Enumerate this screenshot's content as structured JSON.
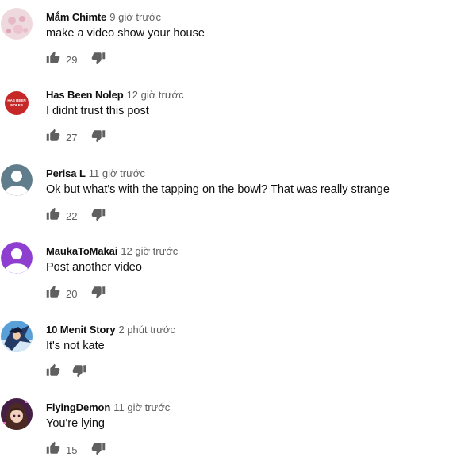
{
  "comments": [
    {
      "author": "Mắm Chimte",
      "time": "9 giờ trước",
      "text": "make a video show your house",
      "likes": "29",
      "avatar_icon": "pink-floral-avatar-icon"
    },
    {
      "author": "Has Been Nolep",
      "time": "12 giờ trước",
      "text": "I didnt trust this post",
      "likes": "27",
      "avatar_icon": "red-badge-avatar-icon",
      "avatar_text_1": "HAS BEEN",
      "avatar_text_2": "NOLEP"
    },
    {
      "author": "Perisa L",
      "time": "11 giờ trước",
      "text": "Ok but what's with the tapping on the bowl? That was really strange",
      "likes": "22",
      "avatar_icon": "default-gray-avatar-icon"
    },
    {
      "author": "MaukaToMakai",
      "time": "12 giờ trước",
      "text": "Post another video",
      "likes": "20",
      "avatar_icon": "default-purple-avatar-icon"
    },
    {
      "author": "10 Menit Story",
      "time": "2 phút trước",
      "text": "It's not kate",
      "likes": "",
      "avatar_icon": "anime-character-avatar-icon"
    },
    {
      "author": "FlyingDemon",
      "time": "11 giờ trước",
      "text": "You're lying",
      "likes": "15",
      "avatar_icon": "anime-girl-avatar-icon"
    }
  ],
  "colors": {
    "text": "#0f0f0f",
    "secondary": "#606060",
    "icon": "#606060",
    "purple": "#8e3fd0",
    "gray_avatar": "#607d8b",
    "red_avatar": "#c62828"
  }
}
